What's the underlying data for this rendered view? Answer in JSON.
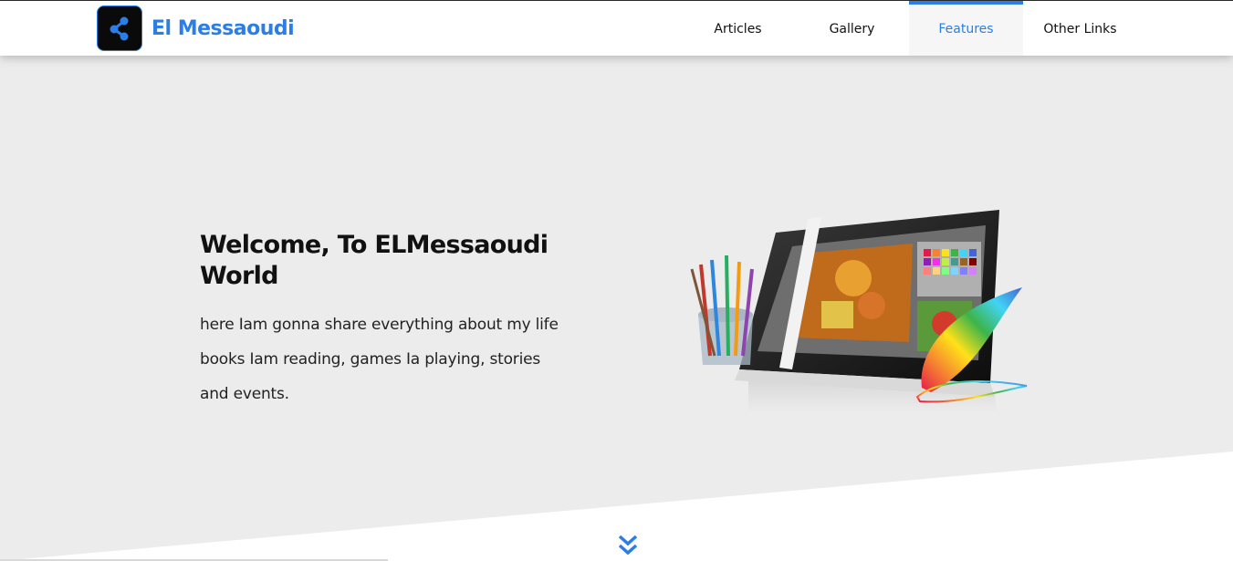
{
  "header": {
    "brand": "El Messaoudi",
    "logo_icon": "share-nodes-icon",
    "nav": [
      {
        "label": "Articles",
        "active": false
      },
      {
        "label": "Gallery",
        "active": false
      },
      {
        "label": "Features",
        "active": true
      },
      {
        "label": "Other Links",
        "active": false
      }
    ]
  },
  "hero": {
    "title": "Welcome, To ELMessaoudi World",
    "description": "here Iam gonna share everything about my life books Iam reading, games Ia playing, stories and events.",
    "image": "laptop-graphic-design-illustration"
  },
  "scroll_icon": "double-chevron-down-icon",
  "colors": {
    "accent": "#2b7ee6",
    "hero_bg": "#ececec",
    "header_bg": "#ffffff"
  }
}
